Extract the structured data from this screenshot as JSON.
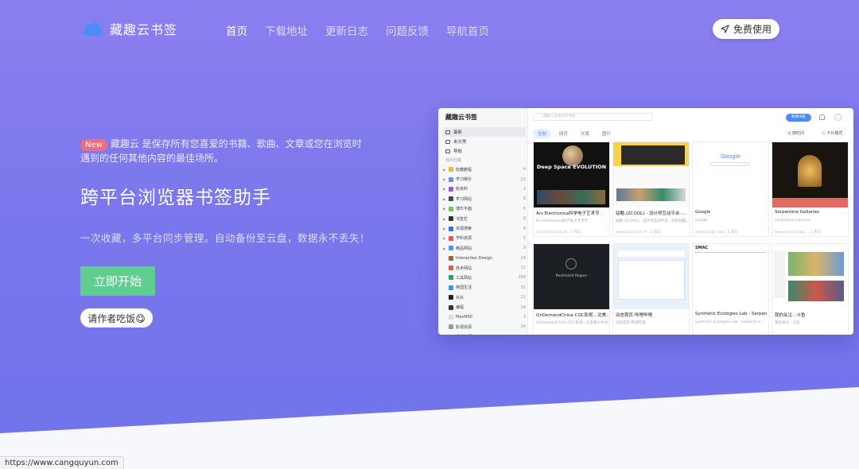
{
  "nav": {
    "brand": "藏趣云书签",
    "links": [
      "首页",
      "下载地址",
      "更新日志",
      "问题反馈",
      "导航首页"
    ],
    "free_button": "免费使用"
  },
  "hero": {
    "badge": "New",
    "intro": "藏趣云 是保存所有您喜爱的书籍、歌曲、文章或您在浏览时遇到的任何其他内容的最佳场所。",
    "headline": "跨平台浏览器书签助手",
    "subline": "一次收藏，多平台同步管理。自动备份至云盘，数据永不丢失！",
    "start_button": "立即开始",
    "treat_button": "请作者吃饭😋"
  },
  "mockup": {
    "app_title": "藏趣云书签",
    "nav": [
      "最新",
      "未分类",
      "导航"
    ],
    "my_label": "我的收藏",
    "folders": [
      {
        "name": "收藏教程",
        "count": "4",
        "color": "#f5b332",
        "arrow": true
      },
      {
        "name": "学习娱乐",
        "count": "22",
        "color": "#6c8cf5",
        "arrow": true
      },
      {
        "name": "收资料",
        "count": "2",
        "color": "#9b59d0",
        "arrow": true
      },
      {
        "name": "学习网站",
        "count": "8",
        "color": "#444a5a",
        "arrow": true
      },
      {
        "name": "博乐平面",
        "count": "6",
        "color": "#7bc34a",
        "arrow": true
      },
      {
        "name": "书签栏",
        "count": "9",
        "color": "#333333",
        "arrow": true
      },
      {
        "name": "资源搜索",
        "count": "6",
        "color": "#3a6ef0",
        "arrow": true
      },
      {
        "name": "学科资源",
        "count": "5",
        "color": "#e2574c",
        "arrow": true
      },
      {
        "name": "精品网站",
        "count": "9",
        "color": "#5a8ef7",
        "arrow": true
      },
      {
        "name": "Interaction Design",
        "count": "24",
        "color": "#8b6e3c",
        "arrow": false
      },
      {
        "name": "技术网站",
        "count": "11",
        "color": "#e2574c",
        "arrow": false
      },
      {
        "name": "工具网站",
        "count": "166",
        "color": "#2a9d8f",
        "arrow": false
      },
      {
        "name": "英国生活",
        "count": "31",
        "color": "#4a90e2",
        "arrow": false
      },
      {
        "name": "抖抖",
        "count": "21",
        "color": "#222222",
        "arrow": false
      },
      {
        "name": "编程",
        "count": "24",
        "color": "#333333",
        "arrow": false
      },
      {
        "name": "MaxMSP",
        "count": "3",
        "color": "#dddddd",
        "arrow": false
      },
      {
        "name": "影视资源",
        "count": "34",
        "color": "#999999",
        "arrow": false
      },
      {
        "name": "其他资源",
        "count": "5",
        "color": "#e6d34a",
        "arrow": false
      }
    ],
    "search_placeholder": "搜索人员地址的书签",
    "new_button": "新增书签",
    "tabs": [
      "全部",
      "网页",
      "文章",
      "图片"
    ],
    "sort_label": "按时间",
    "view_label": "卡片模式",
    "cards": [
      {
        "title": "Ars Electronica科学电子艺术节",
        "desc": "Ars Electronica科学电子艺术节",
        "meta": "ars.electronica.art · 2 周前",
        "thumb_text": "Deep Space EVOLUTION"
      },
      {
        "title": "站酷 (ZCOOL) - 设计师互动平台 -...",
        "desc": "站酷 (ZCOOL) - 设计师互动平台 - 打开站酷，发现更好的设计！",
        "meta": "www.zcool.com.cn · 2 周前",
        "thumb_text": ""
      },
      {
        "title": "Google",
        "desc": "Google",
        "meta": "www.google.com · 2 周前",
        "thumb_text": "Google"
      },
      {
        "title": "Serpentine Galleries",
        "desc": "Serpentine Galleries",
        "meta": "www.serpentineg... · 2 周前",
        "thumb_text": ""
      },
      {
        "title": "OnDemandChina COC影视 - 北美...",
        "desc": "OnDemandChina COC影视 - 北美最大中文影视平台",
        "meta": "",
        "thumb_text": "Restricted Region"
      },
      {
        "title": "动态首页-哔哩哔哩",
        "desc": "动态首页-哔哩哔哩",
        "meta": "",
        "thumb_text": ""
      },
      {
        "title": "Synthetic Ecologies Lab - Serpen...",
        "desc": "Synthetic Ecologies Lab - Serpentine...",
        "meta": "",
        "thumb_text": "SMAC"
      },
      {
        "title": "我的关注 - 斗鱼",
        "desc": "我的关注 - 斗鱼",
        "meta": "",
        "thumb_text": ""
      }
    ]
  },
  "status_url": "https://www.cangquyun.com"
}
